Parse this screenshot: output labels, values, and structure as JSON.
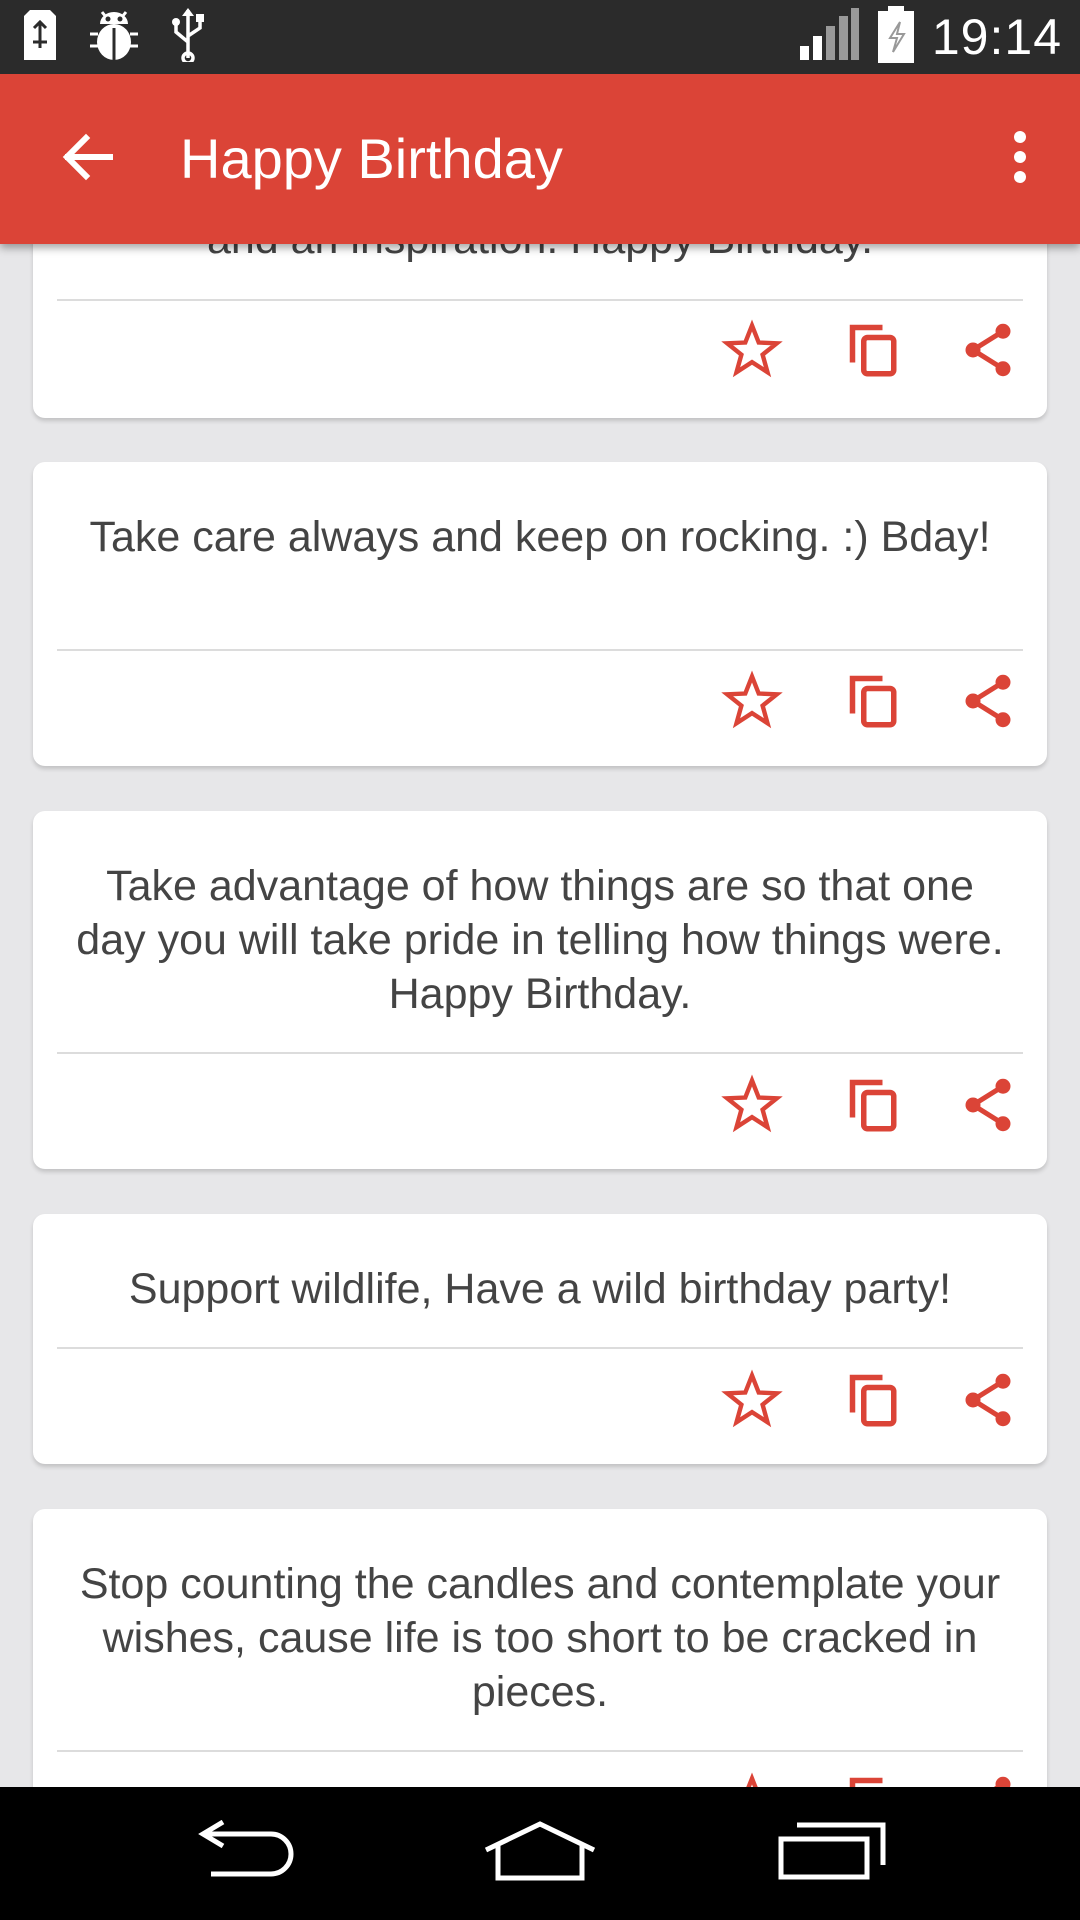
{
  "status_bar": {
    "time": "19:14",
    "left_icons": [
      "sd-card-icon",
      "bug-icon",
      "usb-icon"
    ],
    "right_icons": [
      "signal-icon",
      "battery-icon"
    ]
  },
  "app_bar": {
    "title": "Happy Birthday",
    "back_icon": "arrow-back-icon",
    "menu_icon": "more-vert-icon",
    "color": "#db4437"
  },
  "accent_color": "#db4437",
  "cards": [
    {
      "text": "and an inspiration. Happy Birthday."
    },
    {
      "text": "Take care always and keep on rocking. :) Bday!"
    },
    {
      "text": "Take advantage of how things are so that one day you will take pride in telling how things were. Happy Birthday."
    },
    {
      "text": "Support wildlife, Have a wild birthday party!"
    },
    {
      "text": "Stop counting the candles and contemplate your wishes, cause life is too short to be cracked in pieces."
    }
  ],
  "card_actions": [
    "star-icon",
    "copy-icon",
    "share-icon"
  ],
  "nav_bar": {
    "buttons": [
      "back-icon",
      "home-icon",
      "recents-icon"
    ]
  }
}
